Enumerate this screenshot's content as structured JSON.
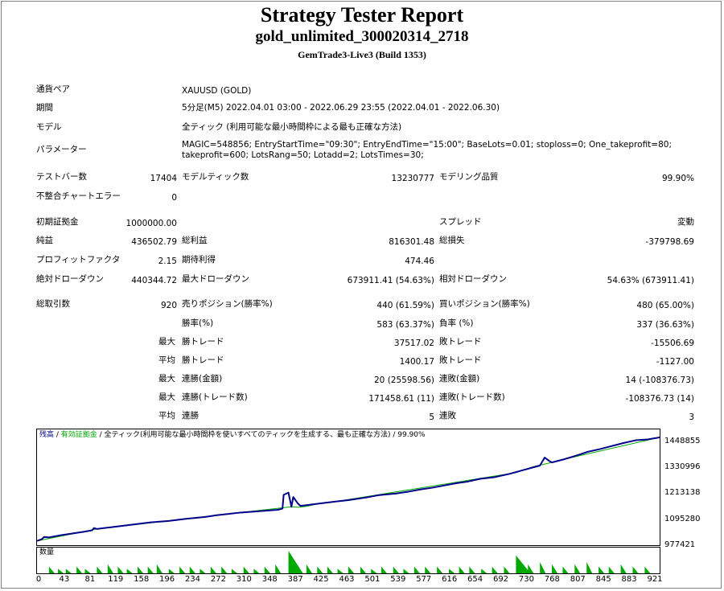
{
  "report": {
    "title": "Strategy Tester Report",
    "expert": "gold_unlimited_300020314_2718",
    "server": "GemTrade3-Live3 (Build 1353)"
  },
  "info": {
    "symbol_label": "通貨ペア",
    "symbol": "XAUUSD (GOLD)",
    "period_label": "期間",
    "period": "5分足(M5) 2022.04.01 03:00 - 2022.06.29 23:55 (2022.04.01 - 2022.06.30)",
    "model_label": "モデル",
    "model": "全ティック (利用可能な最小時間枠による最も正確な方法)",
    "params_label": "パラメーター",
    "params": "MAGIC=548856; EntryStartTime=\"09:30\"; EntryEndTime=\"15:00\"; BaseLots=0.01; stoploss=0; One_takeprofit=80; takeprofit=600; LotsRang=50; Lotadd=2; LotsTimes=30;"
  },
  "stats": {
    "bars_label": "テストバー数",
    "bars": "17404",
    "ticks_label": "モデルティック数",
    "ticks": "13230777",
    "quality_label": "モデリング品質",
    "quality": "99.90%",
    "mismatch_label": "不整合チャートエラー",
    "mismatch": "0",
    "deposit_label": "初期証拠金",
    "deposit": "1000000.00",
    "spread_label": "スプレッド",
    "spread": "変動",
    "net_label": "純益",
    "net": "436502.79",
    "gross_profit_label": "総利益",
    "gross_profit": "816301.48",
    "gross_loss_label": "総損失",
    "gross_loss": "-379798.69",
    "pf_label": "プロフィットファクタ",
    "pf": "2.15",
    "payoff_label": "期待利得",
    "payoff": "474.46",
    "abs_dd_label": "絶対ドローダウン",
    "abs_dd": "440344.72",
    "max_dd_label": "最大ドローダウン",
    "max_dd": "673911.41 (54.63%)",
    "rel_dd_label": "相対ドローダウン",
    "rel_dd": "54.63% (673911.41)",
    "trades_label": "総取引数",
    "trades": "920",
    "short_label": "売りポジション(勝率%)",
    "short": "440 (61.59%)",
    "long_label": "買いポジション(勝率%)",
    "long": "480 (65.00%)",
    "winrate_label": "勝率(%)",
    "winrate": "583 (63.37%)",
    "lossrate_label": "負率 (%)",
    "lossrate": "337 (36.63%)",
    "max_label": "最大",
    "avg_label": "平均",
    "win_trade_label": "勝トレード",
    "loss_trade_label": "敗トレード",
    "max_win": "37517.02",
    "max_loss": "-15506.69",
    "avg_win": "1400.17",
    "avg_loss": "-1127.00",
    "cons_win_amt_label": "連勝(金額)",
    "cons_win_amt": "20 (25598.56)",
    "cons_loss_amt_label": "連敗(金額)",
    "cons_loss_amt": "14 (-108376.73)",
    "cons_win_cnt_label": "連勝(トレード数)",
    "cons_win_cnt": "171458.61 (11)",
    "cons_loss_cnt_label": "連敗(トレード数)",
    "cons_loss_cnt": "-108376.73 (14)",
    "avg_cons_win_label": "連勝",
    "avg_cons_win": "5",
    "avg_cons_loss_label": "連敗",
    "avg_cons_loss": "3"
  },
  "chart_legend": {
    "balance": "残高",
    "sep1": " / ",
    "equity": "有効証拠金",
    "rest": " / 全ティック(利用可能な最小時間枠を使いすべてのティックを生成する、最も正確な方法) / 99.90%"
  },
  "colors": {
    "balance": "#00008b",
    "equity": "#00aa00",
    "volume": "#00aa00"
  },
  "chart_data": {
    "type": "line",
    "title": "",
    "volume_label": "数量",
    "yticks": [
      "1448855",
      "1330996",
      "1213138",
      "1095280",
      "977421"
    ],
    "ylim": [
      977421,
      1448855
    ],
    "xticks": [
      "0",
      "43",
      "81",
      "119",
      "158",
      "196",
      "234",
      "272",
      "310",
      "348",
      "387",
      "425",
      "463",
      "501",
      "539",
      "577",
      "616",
      "654",
      "692",
      "730",
      "768",
      "807",
      "845",
      "883",
      "921"
    ],
    "xlim": [
      0,
      936
    ],
    "series": [
      {
        "name": "残高",
        "points": [
          [
            0,
            982000
          ],
          [
            8,
            990000
          ],
          [
            12,
            1000000
          ],
          [
            20,
            998000
          ],
          [
            40,
            1008000
          ],
          [
            60,
            1016000
          ],
          [
            80,
            1024000
          ],
          [
            92,
            1030000
          ],
          [
            95,
            1040000
          ],
          [
            100,
            1036000
          ],
          [
            130,
            1046000
          ],
          [
            160,
            1056000
          ],
          [
            190,
            1066000
          ],
          [
            220,
            1072000
          ],
          [
            250,
            1082000
          ],
          [
            280,
            1090000
          ],
          [
            300,
            1098000
          ],
          [
            320,
            1104000
          ],
          [
            340,
            1110000
          ],
          [
            360,
            1114000
          ],
          [
            380,
            1118000
          ],
          [
            400,
            1122000
          ],
          [
            410,
            1128000
          ],
          [
            425,
            1136000
          ],
          [
            440,
            1140000
          ],
          [
            470,
            1150000
          ],
          [
            500,
            1160000
          ],
          [
            520,
            1166000
          ],
          [
            550,
            1178000
          ],
          [
            570,
            1188000
          ],
          [
            600,
            1196000
          ],
          [
            620,
            1204000
          ],
          [
            640,
            1214000
          ],
          [
            660,
            1222000
          ],
          [
            680,
            1232000
          ],
          [
            700,
            1242000
          ],
          [
            720,
            1250000
          ],
          [
            740,
            1262000
          ],
          [
            765,
            1270000
          ],
          [
            790,
            1285000
          ],
          [
            810,
            1300000
          ],
          [
            840,
            1322000
          ],
          [
            860,
            1336000
          ],
          [
            880,
            1350000
          ],
          [
            900,
            1366000
          ],
          [
            920,
            1384000
          ],
          [
            940,
            1396000
          ],
          [
            960,
            1410000
          ],
          [
            980,
            1424000
          ],
          [
            1000,
            1436000
          ],
          [
            1020,
            1440000
          ],
          [
            1040,
            1448855
          ]
        ]
      },
      {
        "name": "有効証拠金",
        "points": [
          [
            0,
            982000
          ],
          [
            100,
            1036000
          ],
          [
            300,
            1098000
          ],
          [
            425,
            1136000
          ],
          [
            438,
            1134000
          ],
          [
            450,
            1138000
          ],
          [
            470,
            1150000
          ],
          [
            500,
            1160000
          ],
          [
            800,
            1290000
          ],
          [
            830,
            1318000
          ],
          [
            860,
            1336000
          ],
          [
            880,
            1350000
          ],
          [
            1040,
            1448855
          ]
        ]
      }
    ],
    "spike_points": [
      [
        405,
        1124000
      ],
      [
        412,
        1190000
      ],
      [
        420,
        1200000
      ],
      [
        428,
        1180000
      ],
      [
        436,
        1150000
      ],
      [
        840,
        1322000
      ],
      [
        848,
        1358000
      ],
      [
        856,
        1342000
      ]
    ],
    "volume": [
      [
        20,
        3
      ],
      [
        35,
        2
      ],
      [
        48,
        2
      ],
      [
        66,
        3
      ],
      [
        80,
        2
      ],
      [
        100,
        3
      ],
      [
        118,
        4
      ],
      [
        135,
        3
      ],
      [
        150,
        2
      ],
      [
        168,
        3
      ],
      [
        185,
        3
      ],
      [
        200,
        4
      ],
      [
        220,
        2
      ],
      [
        238,
        3
      ],
      [
        255,
        3
      ],
      [
        272,
        2
      ],
      [
        290,
        3
      ],
      [
        308,
        3
      ],
      [
        325,
        2
      ],
      [
        345,
        3
      ],
      [
        362,
        2
      ],
      [
        380,
        3
      ],
      [
        398,
        4
      ],
      [
        420,
        10
      ],
      [
        450,
        4
      ],
      [
        468,
        3
      ],
      [
        485,
        3
      ],
      [
        502,
        2
      ],
      [
        520,
        3
      ],
      [
        540,
        3
      ],
      [
        558,
        2
      ],
      [
        575,
        3
      ],
      [
        595,
        3
      ],
      [
        612,
        2
      ],
      [
        630,
        3
      ],
      [
        648,
        3
      ],
      [
        668,
        3
      ],
      [
        688,
        2
      ],
      [
        705,
        3
      ],
      [
        722,
        3
      ],
      [
        742,
        2
      ],
      [
        760,
        3
      ],
      [
        780,
        3
      ],
      [
        800,
        8
      ],
      [
        820,
        4
      ],
      [
        840,
        5
      ],
      [
        860,
        4
      ],
      [
        878,
        3
      ],
      [
        898,
        4
      ],
      [
        918,
        5
      ],
      [
        938,
        3
      ],
      [
        955,
        3
      ],
      [
        975,
        4
      ],
      [
        995,
        3
      ],
      [
        1015,
        3
      ]
    ]
  }
}
